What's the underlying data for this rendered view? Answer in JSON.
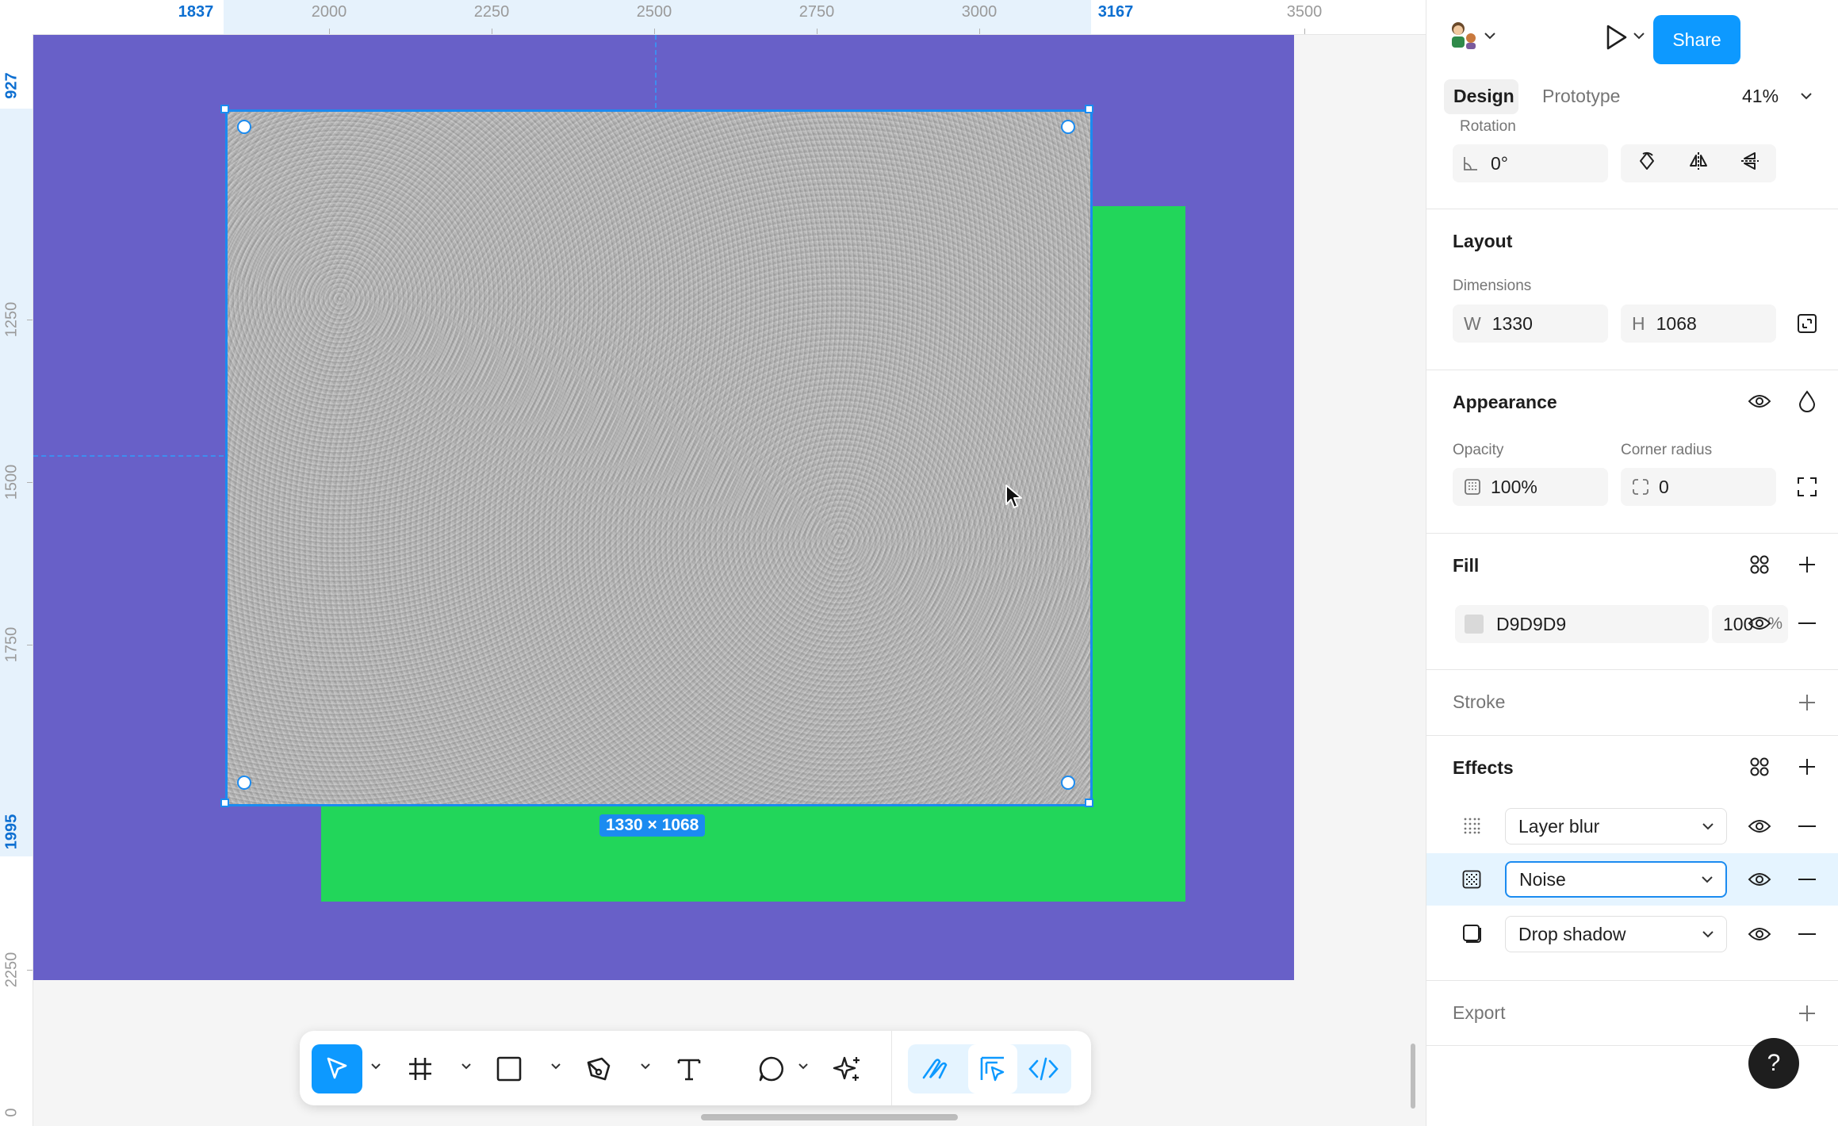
{
  "rulers": {
    "top": [
      "1837",
      "2000",
      "2250",
      "2500",
      "2750",
      "3000",
      "3167",
      "3500"
    ],
    "top_selected": [
      "1837",
      "3167"
    ],
    "left": [
      "927",
      "1250",
      "1500",
      "1750",
      "1995",
      "2250",
      "0"
    ],
    "left_selected": [
      "927",
      "1995"
    ]
  },
  "canvas": {
    "frame_color": "#6860c8",
    "green_color": "#22d65a",
    "selection_size": "1330 × 1068"
  },
  "toolbar": {
    "tools": [
      "move",
      "frame",
      "rectangle",
      "pen",
      "text",
      "comment",
      "ai"
    ],
    "modes": [
      "draw",
      "design",
      "dev"
    ]
  },
  "header": {
    "share_label": "Share",
    "tabs": {
      "design": "Design",
      "prototype": "Prototype"
    },
    "zoom": "41%"
  },
  "rotation": {
    "label": "Rotation",
    "value": "0°"
  },
  "layout": {
    "title": "Layout",
    "dimensions_label": "Dimensions",
    "w_prefix": "W",
    "w_value": "1330",
    "h_prefix": "H",
    "h_value": "1068"
  },
  "appearance": {
    "title": "Appearance",
    "opacity_label": "Opacity",
    "opacity_value": "100%",
    "corner_label": "Corner radius",
    "corner_value": "0"
  },
  "fill": {
    "title": "Fill",
    "hex": "D9D9D9",
    "opacity": "100",
    "unit": "%"
  },
  "stroke": {
    "title": "Stroke"
  },
  "effects": {
    "title": "Effects",
    "items": [
      {
        "label": "Layer blur"
      },
      {
        "label": "Noise"
      },
      {
        "label": "Drop shadow"
      }
    ]
  },
  "export": {
    "title": "Export"
  },
  "help": {
    "label": "?"
  }
}
